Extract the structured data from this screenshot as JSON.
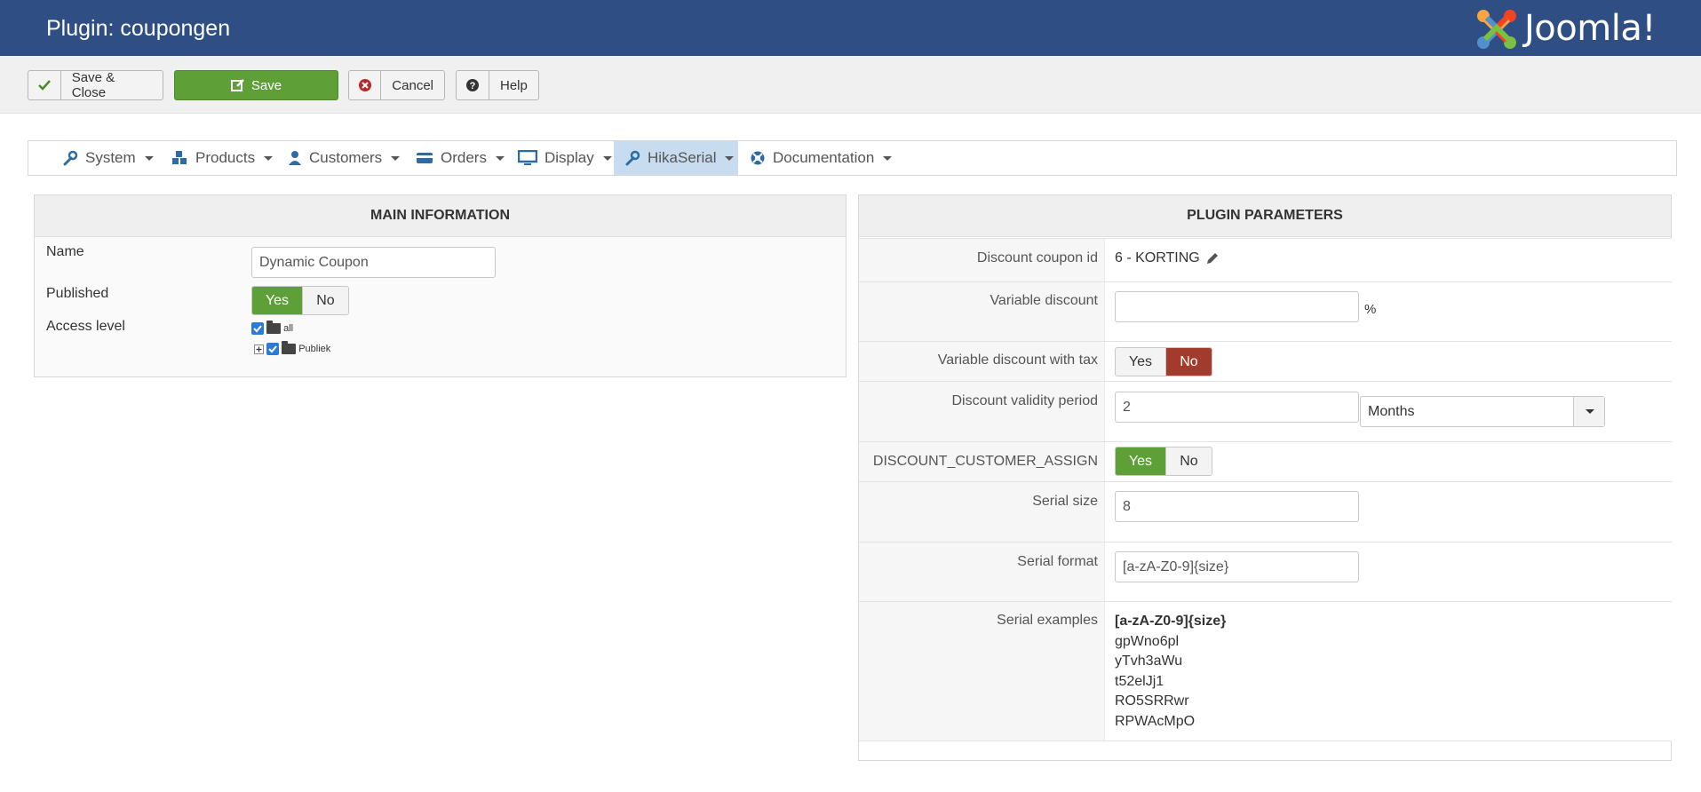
{
  "header": {
    "title": "Plugin: coupongen",
    "logo_text": "Joomla!"
  },
  "toolbar": {
    "save_close": "Save & Close",
    "save": "Save",
    "cancel": "Cancel",
    "help": "Help"
  },
  "nav": {
    "items": [
      {
        "label": "System",
        "icon": "wrench-icon"
      },
      {
        "label": "Products",
        "icon": "cubes-icon"
      },
      {
        "label": "Customers",
        "icon": "user-icon"
      },
      {
        "label": "Orders",
        "icon": "credit-card-icon"
      },
      {
        "label": "Display",
        "icon": "monitor-icon"
      },
      {
        "label": "HikaSerial",
        "icon": "wrench-icon",
        "active": true
      },
      {
        "label": "Documentation",
        "icon": "lifebuoy-icon"
      }
    ]
  },
  "main": {
    "heading": "MAIN INFORMATION",
    "name_label": "Name",
    "name_value": "Dynamic Coupon",
    "published_label": "Published",
    "published_yes": "Yes",
    "published_no": "No",
    "published_value": "Yes",
    "access_label": "Access level",
    "access_tree": [
      {
        "label": "all",
        "checked": true
      },
      {
        "label": "Publiek",
        "checked": true
      }
    ]
  },
  "params": {
    "heading": "PLUGIN PARAMETERS",
    "coupon_id_label": "Discount coupon id",
    "coupon_id_value": "6 - KORTING",
    "variable_discount_label": "Variable discount",
    "variable_discount_value": "",
    "percent_sign": "%",
    "var_tax_label": "Variable discount with tax",
    "var_tax_yes": "Yes",
    "var_tax_no": "No",
    "var_tax_value": "No",
    "validity_label": "Discount validity period",
    "validity_value": "2",
    "validity_unit": "Months",
    "assign_label": "DISCOUNT_CUSTOMER_ASSIGN",
    "assign_yes": "Yes",
    "assign_no": "No",
    "assign_value": "Yes",
    "serial_size_label": "Serial size",
    "serial_size_value": "8",
    "serial_format_label": "Serial format",
    "serial_format_value": "[a-zA-Z0-9]{size}",
    "serial_examples_label": "Serial examples",
    "serial_examples_pattern": "[a-zA-Z0-9]{size}",
    "serial_examples": [
      "gpWno6pl",
      "yTvh3aWu",
      "t52elJj1",
      "RO5SRRwr",
      "RPWAcMpO"
    ]
  },
  "colors": {
    "header_bg": "#2f4e83",
    "green": "#5f9f38",
    "red": "#a23b2b",
    "nav_active": "#c7dcee"
  }
}
